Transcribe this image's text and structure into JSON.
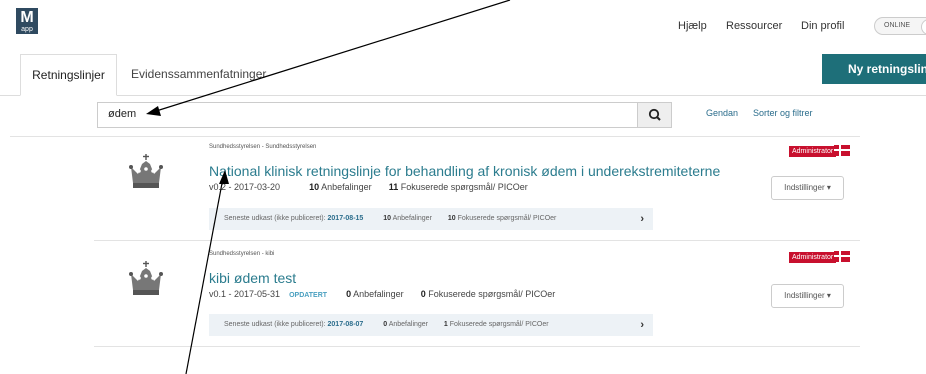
{
  "logo": {
    "letter": "M",
    "sub": "app"
  },
  "topnav": {
    "help": "Hjælp",
    "resources": "Ressourcer",
    "profile": "Din profil",
    "status": "ONLINE"
  },
  "tabs": [
    {
      "label": "Retningslinjer"
    },
    {
      "label": "Evidenssammenfatninger"
    }
  ],
  "new_button": "Ny retningslinje",
  "search": {
    "value": "ødem",
    "actions": {
      "reset": "Gendan",
      "sort": "Sorter og filtrer"
    }
  },
  "results": [
    {
      "source": "Sundhedsstyrelsen - Sundhedsstyrelsen",
      "title": "National klinisk retningslinje for behandling af kronisk ødem i underekstremiteterne",
      "version": "v0.2 - 2017-03-20",
      "updated": "",
      "rec_count": "10",
      "rec_label": "Anbefalinger",
      "q_count": "11",
      "q_label": "Fokuserede spørgsmål/ PICOer",
      "draft_label": "Seneste udkast (ikke publiceret):",
      "draft_date": "2017-08-15",
      "draft_rec": "10",
      "draft_rec_label": "Anbefalinger",
      "draft_q": "10",
      "draft_q_label": "Fokuserede spørgsmål/ PICOer",
      "role": "Administrator",
      "settings": "Indstillinger ▾"
    },
    {
      "source": "Sundhedsstyrelsen - kibi",
      "title": "kibi ødem test",
      "version": "v0.1 - 2017-05-31",
      "updated": "OPDATERT",
      "rec_count": "0",
      "rec_label": "Anbefalinger",
      "q_count": "0",
      "q_label": "Fokuserede spørgsmål/ PICOer",
      "draft_label": "Seneste udkast (ikke publiceret):",
      "draft_date": "2017-08-07",
      "draft_rec": "0",
      "draft_rec_label": "Anbefalinger",
      "draft_q": "1",
      "draft_q_label": "Fokuserede spørgsmål/ PICOer",
      "role": "Administrator",
      "settings": "Indstillinger ▾"
    }
  ],
  "colors": {
    "accent": "#2b7c8e",
    "primary_button": "#1e6f79",
    "admin_badge": "#c8102e"
  },
  "icons": [
    "search-icon",
    "crown-icon",
    "danish-flag-icon",
    "chevron-right-icon",
    "caret-down-icon"
  ]
}
